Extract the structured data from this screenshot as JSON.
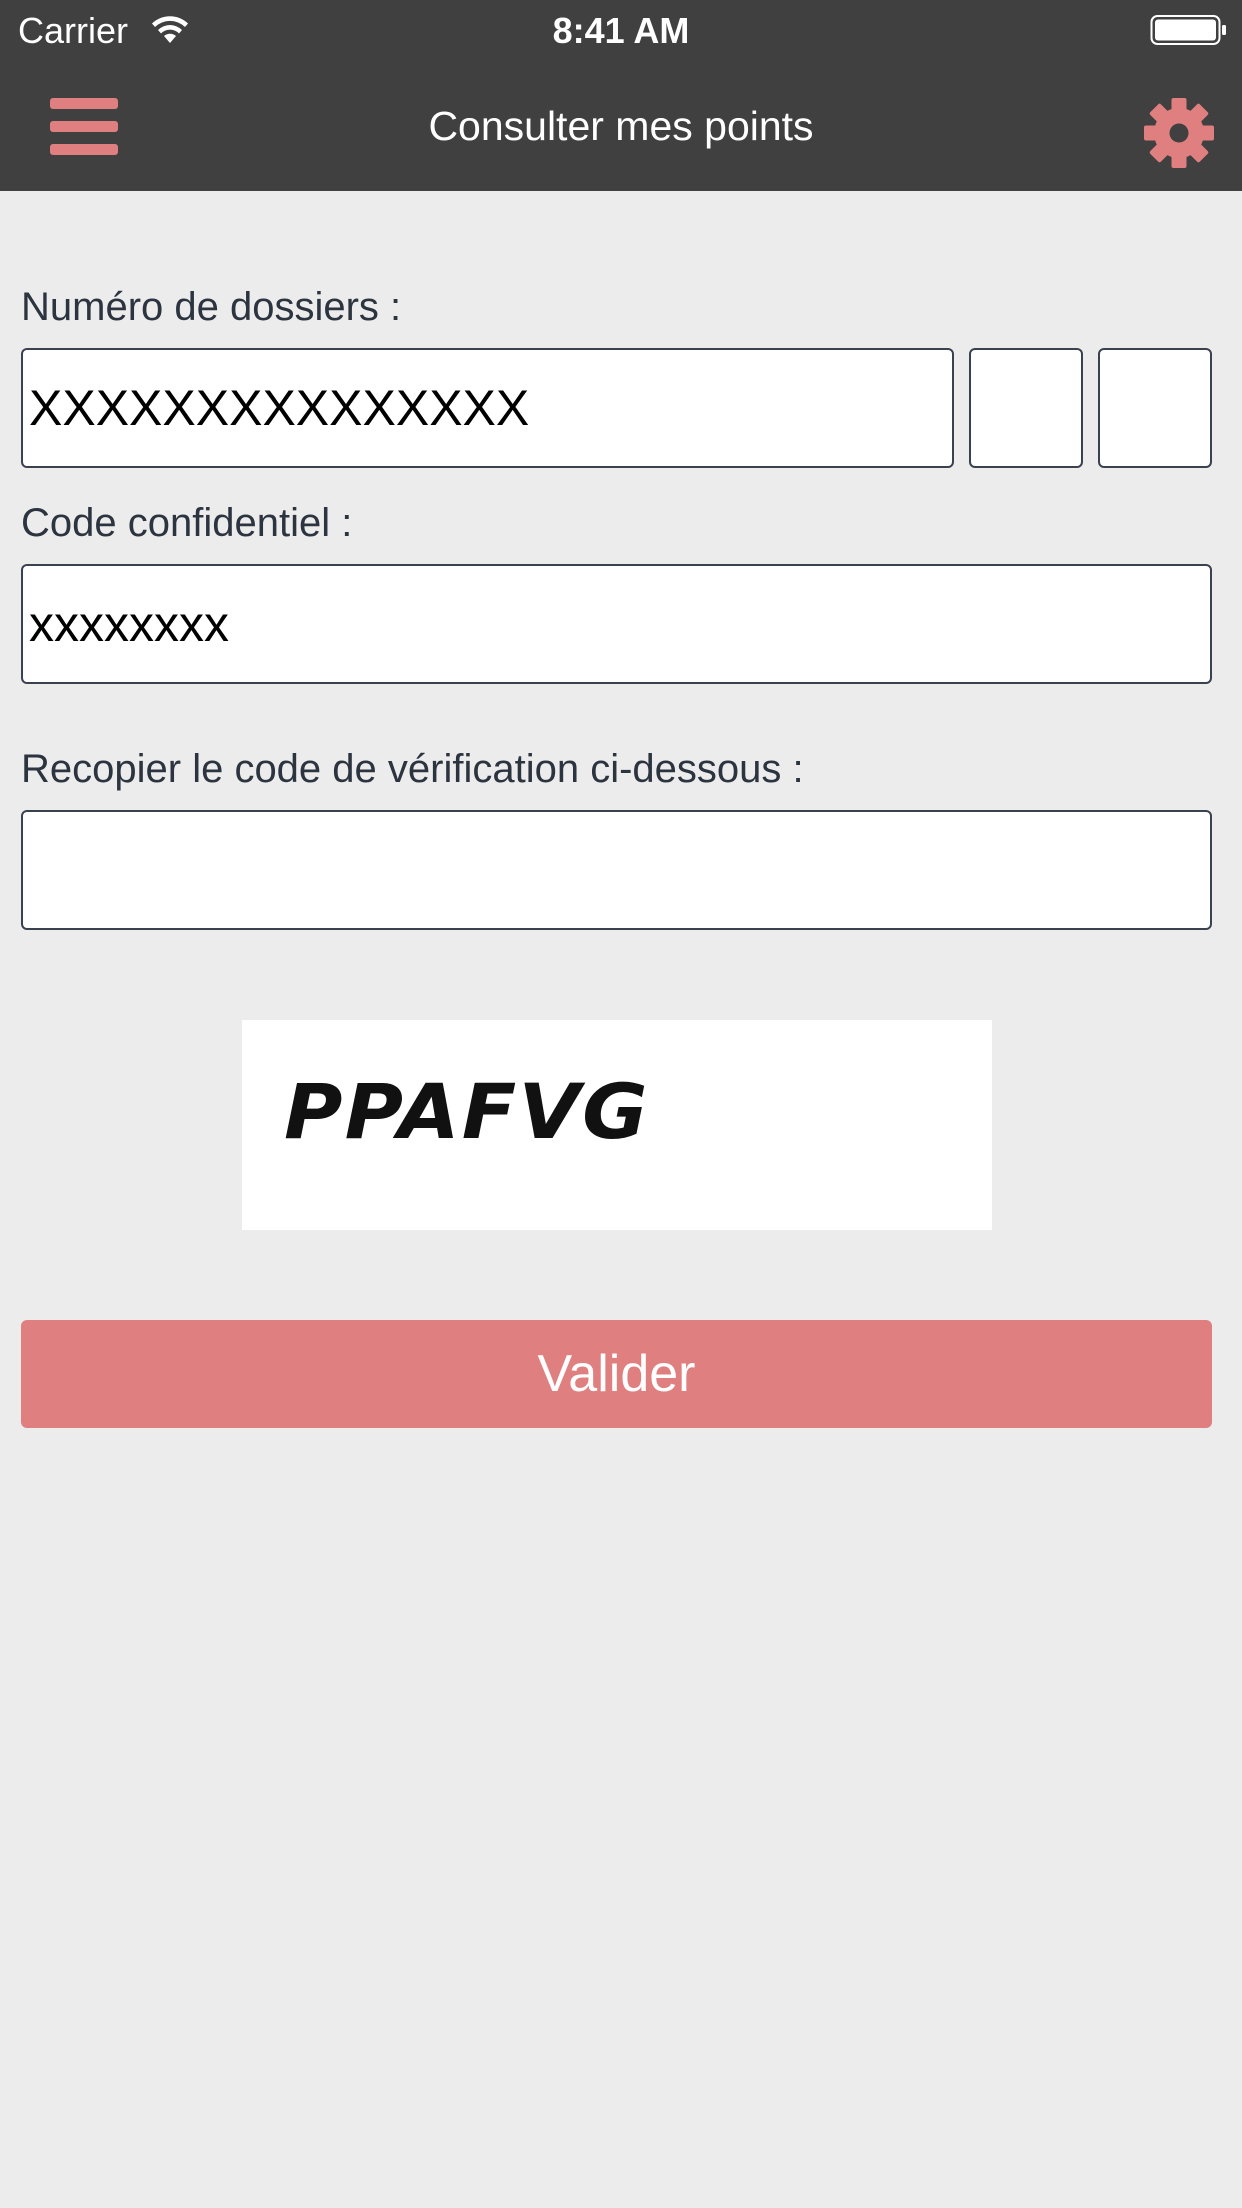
{
  "status_bar": {
    "carrier": "Carrier",
    "time": "8:41 AM",
    "wifi_icon": "wifi-icon",
    "battery_icon": "battery-icon"
  },
  "nav": {
    "title": "Consulter mes points",
    "menu_icon": "hamburger-menu-icon",
    "settings_icon": "gear-icon",
    "accent_color": "#e07f80",
    "bar_color": "#404040"
  },
  "form": {
    "dossier": {
      "label": "Numéro de dossiers :",
      "value_main": "XXXXXXXXXXXXXXX",
      "value_part2": "",
      "value_part3": ""
    },
    "code": {
      "label": "Code confidentiel :",
      "value": "xxxxxxxx"
    },
    "verification": {
      "label": "Recopier le code de vérification ci-dessous :",
      "value": ""
    },
    "captcha": {
      "text": "PPAFVG"
    },
    "submit_label": "Valider"
  },
  "colors": {
    "background": "#ececec",
    "button": "#e07f80",
    "label_text": "#2c3440"
  }
}
